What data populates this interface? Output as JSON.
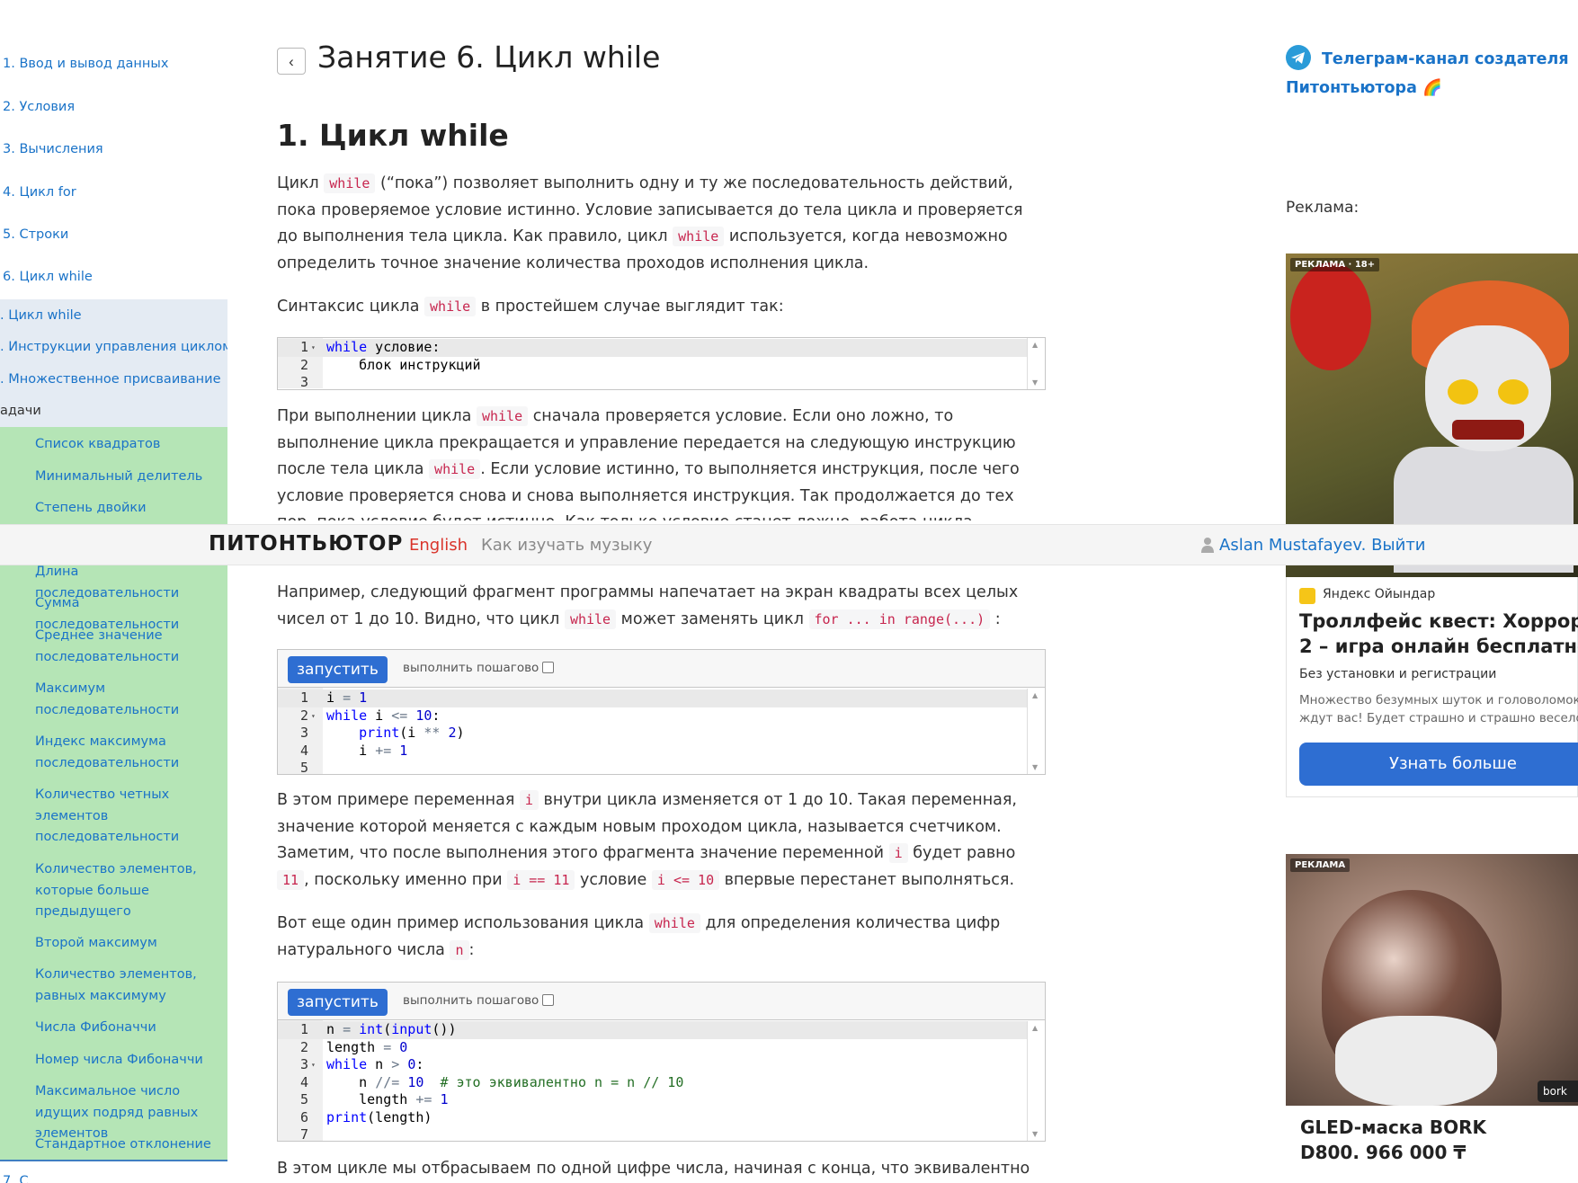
{
  "sidebar": {
    "lessons": [
      "1. Ввод и вывод данных",
      "2. Условия",
      "3. Вычисления",
      "4. Цикл for",
      "5. Строки",
      "6. Цикл while"
    ],
    "sections": [
      ". Цикл while",
      ". Инструкции управления циклом",
      ". Множественное присваивание",
      "адачи"
    ],
    "tasks": [
      "Список квадратов",
      "Минимальный делитель",
      "Степень двойки",
      "Длина последовательности",
      "Сумма последовательности",
      "Среднее значение последовательности",
      "Максимум последовательности",
      "Индекс максимума последовательности",
      "Количество четных элементов последовательности",
      "Количество элементов, которые больше предыдущего",
      "Второй максимум",
      "Количество элементов, равных максимуму",
      "Числа Фибоначчи",
      "Номер числа Фибоначчи",
      "Максимальное число идущих подряд равных элементов",
      "Стандартное отклонение"
    ],
    "bottom_item": "7. С"
  },
  "main": {
    "back_glyph": "‹",
    "title": "Занятие 6. Цикл while",
    "section_heading": "1. Цикл while",
    "p1": {
      "a": "Цикл ",
      "c1": "while",
      "b": " (“пока”) позволяет выполнить одну и ту же последовательность действий, пока проверяемое условие истинно. Условие записывается до тела цикла и проверяется до выполнения тела цикла. Как правило, цикл ",
      "c2": "while",
      "d": " используется, когда невозможно определить точное значение количества проходов исполнения цикла."
    },
    "p2": {
      "a": "Синтаксис цикла ",
      "c1": "while",
      "b": " в простейшем случае выглядит так:"
    },
    "code1": {
      "line_numbers": [
        "1",
        "2",
        "3"
      ],
      "l1_kw": "while",
      "l1_rest": " условие:",
      "l2": "    блок инструкций",
      "l3": ""
    },
    "p3": {
      "a": "При выполнении цикла ",
      "c1": "while",
      "b": " сначала проверяется условие. Если оно ложно, то выполнение цикла прекращается и управление передается на следующую инструкцию после тела цикла ",
      "c2": "while",
      "d": ". Если условие истинно, то выполняется инструкция, после чего условие проверяется снова и снова выполняется инструкция. Так продолжается до тех пор, пока условие будет истинно. Как только условие станет ложно, работа цикла завершится и управление передастся"
    },
    "p4": {
      "a": "Например, следующий фрагмент программы напечатает на экран квадраты всех целых чисел от 1 до 10. Видно, что цикл ",
      "c1": "while",
      "b": " может заменять цикл ",
      "c2": "for ... in range(...)",
      "d": " :"
    },
    "run_label": "запустить",
    "step_label": "выполнить пошагово",
    "code2": {
      "line_numbers": [
        "1",
        "2",
        "3",
        "4",
        "5"
      ]
    },
    "p5": {
      "a": "В этом примере переменная ",
      "c1": "i",
      "b": " внутри цикла изменяется от 1 до 10. Такая переменная, значение которой меняется с каждым новым проходом цикла, называется счетчиком. Заметим, что после выполнения этого фрагмента значение переменной ",
      "c2": "i",
      "d": " будет равно ",
      "c3": "11",
      "e": ", поскольку именно при ",
      "c4": "i == 11",
      "f": " условие ",
      "c5": "i <= 10",
      "g": " впервые перестанет выполняться."
    },
    "p6": {
      "a": "Вот еще один пример использования цикла ",
      "c1": "while",
      "b": " для определения количества цифр натурального числа ",
      "c2": "n",
      "d": ":"
    },
    "code3": {
      "line_numbers": [
        "1",
        "2",
        "3",
        "4",
        "5",
        "6",
        "7"
      ],
      "comment": "# это эквивалентно n = n // 10"
    },
    "p7": "В этом цикле мы отбрасываем по одной цифре числа, начиная с конца, что эквивалентно"
  },
  "right": {
    "telegram_link": "Телеграм-канал создателя Питонтьютора 🌈",
    "ad_label": "Реклама:",
    "ad1": {
      "tag": "РЕКЛАМА · 18+",
      "source": "Яндекс Ойындар",
      "title": "Троллфейс квест: Хоррор 2 – игра онлайн бесплатно",
      "subtitle": "Без установки и регистрации",
      "description": "Множество безумных шуток и головоломок ждут вас! Будет страшно и страшно весело",
      "button": "Узнать больше"
    },
    "ad2": {
      "tag": "РЕКЛАМА",
      "chip": "bork",
      "title": "GLED-маска BORK D800. 966 000 ₸"
    }
  },
  "navbar": {
    "brand": "ПИТОНТЬЮТОР",
    "english": "English",
    "music": "Как изучать музыку",
    "user": "Aslan Mustafayev.",
    "logout": "Выйти"
  },
  "colors": {
    "link": "#1a73c8",
    "tasks_bg": "#b5e5b6",
    "run_button": "#2e6ed2",
    "code_red": "#c7254e",
    "nav_english": "#d9342b"
  }
}
